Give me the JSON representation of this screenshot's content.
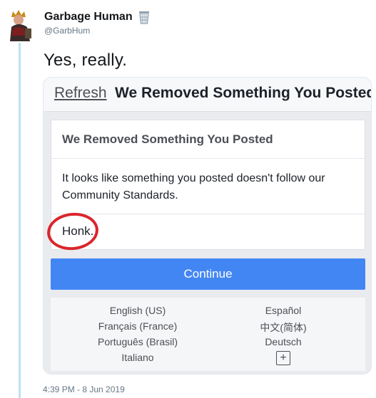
{
  "tweet": {
    "author_name": "Garbage Human",
    "author_emoji_icon": "wastebasket-icon",
    "handle": "@GarbHum",
    "text": "Yes, really.",
    "timestamp": "4:39 PM - 8 Jun 2019"
  },
  "screenshot": {
    "topbar_refresh": "Refresh",
    "topbar_title": "We Removed Something You Posted",
    "box_title": "We Removed Something You Posted",
    "box_body": "It looks like something you posted doesn't follow our Community Standards.",
    "post_text": "Honk.",
    "continue_label": "Continue",
    "languages": {
      "english": "English (US)",
      "espanol": "Español",
      "francais": "Français (France)",
      "chinese": "中文(简体)",
      "portugues": "Português (Brasil)",
      "deutsch": "Deutsch",
      "italiano": "Italiano",
      "more": "+"
    }
  },
  "colors": {
    "accent_blue": "#4286f4",
    "highlight_red": "#d9262c",
    "thread_line": "#bfe0f5"
  }
}
